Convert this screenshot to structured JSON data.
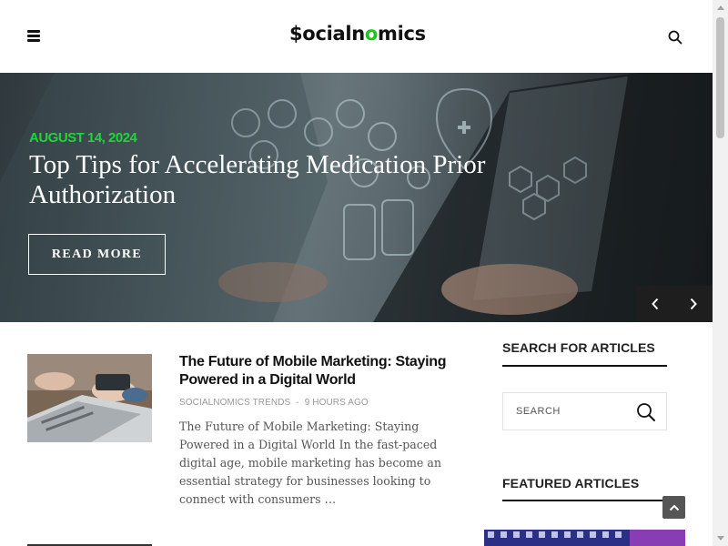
{
  "header": {
    "logo_text_start": "$ocialn",
    "logo_text_accent": "o",
    "logo_text_end": "mics",
    "menu_icon": "hamburger-icon",
    "search_icon": "search-icon"
  },
  "hero": {
    "date": "AUGUST 14, 2024",
    "title": "Top Tips for Accelerating Medication Prior Authorization",
    "read_more": "READ MORE",
    "prev_icon": "chevron-left-icon",
    "next_icon": "chevron-right-icon"
  },
  "article": {
    "title": "The Future of Mobile Marketing: Staying Powered in a Digital World",
    "category": "SOCIALNOMICS TRENDS",
    "separator": "-",
    "time": "9 HOURS AGO",
    "excerpt": "The Future of Mobile Marketing: Staying Powered in a Digital World In the fast-paced digital age, mobile marketing has become an essential strategy for businesses looking to connect with consumers …"
  },
  "sidebar": {
    "search_heading": "SEARCH FOR ARTICLES",
    "search_placeholder": "SEARCH",
    "featured_heading": "FEATURED ARTICLES"
  },
  "colors": {
    "accent_green": "#22d33a",
    "text_dark": "#111111",
    "meta_gray": "#999999"
  }
}
